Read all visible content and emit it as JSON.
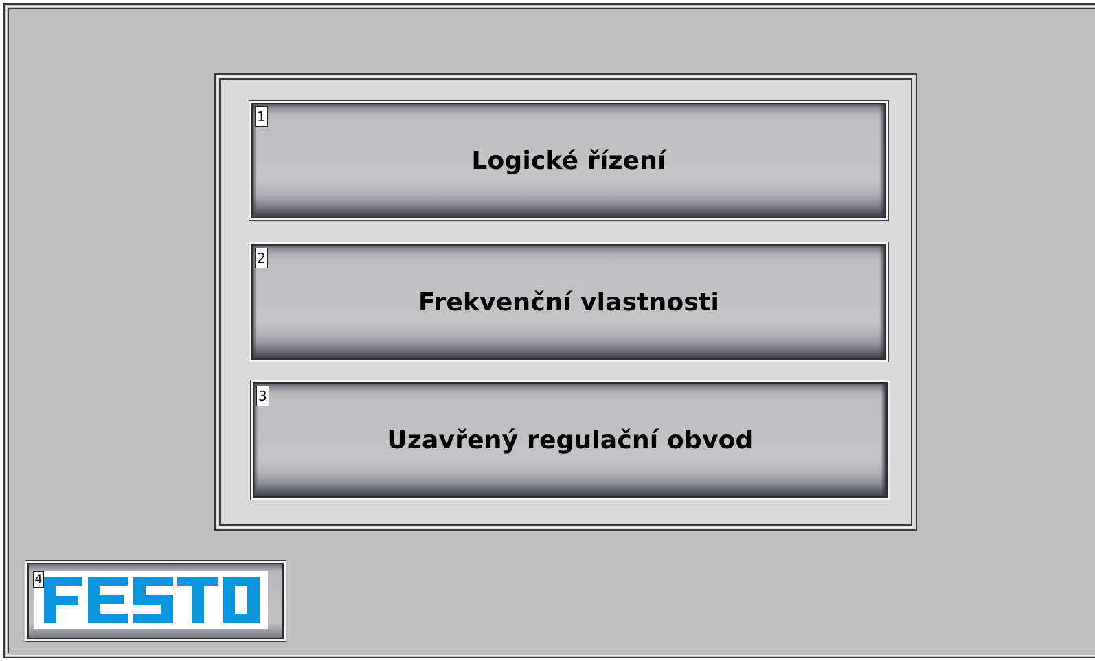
{
  "menu": {
    "buttons": [
      {
        "number": "1",
        "label": "Logické řízení"
      },
      {
        "number": "2",
        "label": "Frekvenční vlastnosti"
      },
      {
        "number": "3",
        "label": "Uzavřený regulační obvod"
      }
    ]
  },
  "logo": {
    "number": "4",
    "text": "FESTO",
    "color": "#0a96dc"
  }
}
